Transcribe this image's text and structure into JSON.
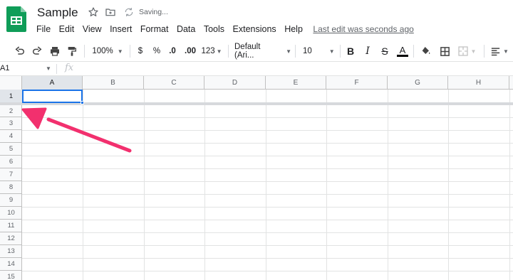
{
  "app": {
    "doc_title": "Sample",
    "status": "Saving...",
    "last_edit": "Last edit was seconds ago",
    "colors": {
      "accent": "#1a73e8",
      "sheets_green": "#0f9d58",
      "arrow": "#f2306e"
    }
  },
  "menubar": {
    "items": [
      {
        "label": "File"
      },
      {
        "label": "Edit"
      },
      {
        "label": "View"
      },
      {
        "label": "Insert"
      },
      {
        "label": "Format"
      },
      {
        "label": "Data"
      },
      {
        "label": "Tools"
      },
      {
        "label": "Extensions"
      },
      {
        "label": "Help"
      }
    ]
  },
  "toolbar": {
    "zoom": "100%",
    "currency": "$",
    "percent": "%",
    "decrease_decimal": ".0",
    "increase_decimal": ".00",
    "more_formats": "123",
    "font": "Default (Ari...",
    "font_size": "10",
    "icons": [
      "undo-icon",
      "redo-icon",
      "print-icon",
      "paint-format-icon",
      "bold-icon",
      "italic-icon",
      "strikethrough-icon",
      "text-color-icon",
      "fill-color-icon",
      "borders-icon",
      "merge-cells-icon",
      "align-icon"
    ]
  },
  "formula_bar": {
    "name_box": "A1",
    "fx": "fx"
  },
  "grid": {
    "columns": [
      "A",
      "B",
      "C",
      "D",
      "E",
      "F",
      "G",
      "H"
    ],
    "rows": [
      "1",
      "2",
      "3",
      "4",
      "5",
      "6",
      "7",
      "8",
      "9",
      "10",
      "11",
      "12",
      "13",
      "14",
      "15"
    ],
    "active_cell": "A1"
  }
}
